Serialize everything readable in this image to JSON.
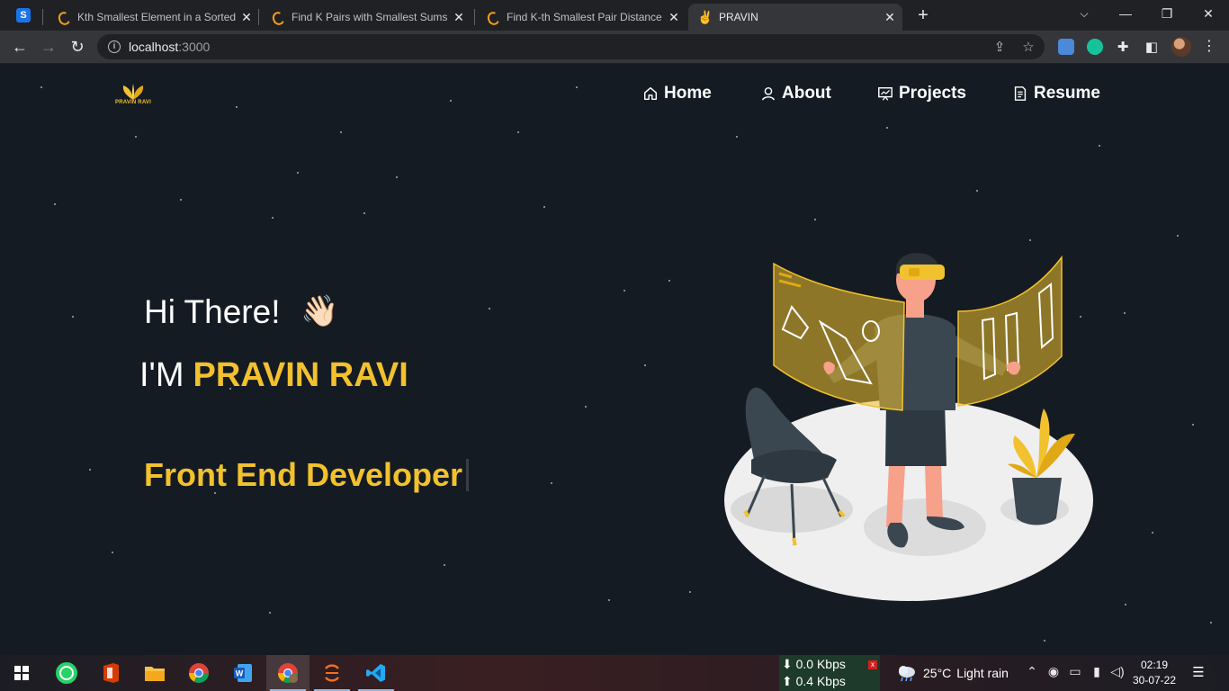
{
  "browser": {
    "tabs": [
      {
        "title": "Kth Smallest Element in a Sorted",
        "active": false
      },
      {
        "title": "Find K Pairs with Smallest Sums -",
        "active": false
      },
      {
        "title": "Find K-th Smallest Pair Distance -",
        "active": false
      },
      {
        "title": "PRAVIN",
        "active": true,
        "favicon": "✌️"
      }
    ],
    "app_badge": "S",
    "url_host": "localhost",
    "url_port": ":3000"
  },
  "site": {
    "logo_text": "PRAVIN RAVI",
    "nav": [
      {
        "label": "Home",
        "icon": "home-icon"
      },
      {
        "label": "About",
        "icon": "user-icon"
      },
      {
        "label": "Projects",
        "icon": "projects-icon"
      },
      {
        "label": "Resume",
        "icon": "document-icon"
      }
    ],
    "greeting": "Hi There!",
    "wave_emoji": "👋🏻",
    "im_prefix": "I'M",
    "name": "PRAVIN RAVI",
    "role": "Front End Developer",
    "accent_color": "#f2c12e",
    "background_color": "#151b22"
  },
  "taskbar": {
    "net_down": "⬇ 0.0 Kbps",
    "net_up": "⬆ 0.4 Kbps",
    "net_badge": "x",
    "temperature": "25°C",
    "weather": "Light rain",
    "time": "02:19",
    "date": "30-07-22"
  }
}
